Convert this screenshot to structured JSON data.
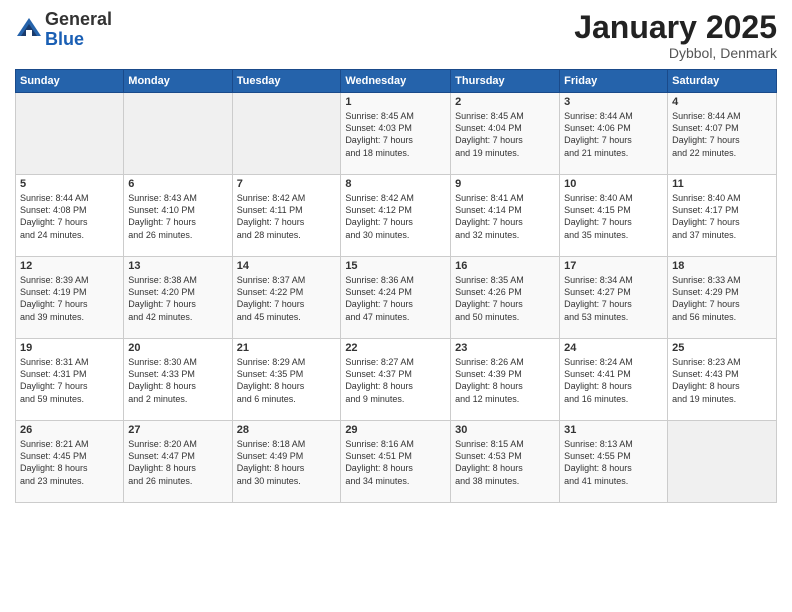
{
  "header": {
    "logo_general": "General",
    "logo_blue": "Blue",
    "month_title": "January 2025",
    "location": "Dybbol, Denmark"
  },
  "weekdays": [
    "Sunday",
    "Monday",
    "Tuesday",
    "Wednesday",
    "Thursday",
    "Friday",
    "Saturday"
  ],
  "weeks": [
    [
      {
        "day": "",
        "content": ""
      },
      {
        "day": "",
        "content": ""
      },
      {
        "day": "",
        "content": ""
      },
      {
        "day": "1",
        "content": "Sunrise: 8:45 AM\nSunset: 4:03 PM\nDaylight: 7 hours\nand 18 minutes."
      },
      {
        "day": "2",
        "content": "Sunrise: 8:45 AM\nSunset: 4:04 PM\nDaylight: 7 hours\nand 19 minutes."
      },
      {
        "day": "3",
        "content": "Sunrise: 8:44 AM\nSunset: 4:06 PM\nDaylight: 7 hours\nand 21 minutes."
      },
      {
        "day": "4",
        "content": "Sunrise: 8:44 AM\nSunset: 4:07 PM\nDaylight: 7 hours\nand 22 minutes."
      }
    ],
    [
      {
        "day": "5",
        "content": "Sunrise: 8:44 AM\nSunset: 4:08 PM\nDaylight: 7 hours\nand 24 minutes."
      },
      {
        "day": "6",
        "content": "Sunrise: 8:43 AM\nSunset: 4:10 PM\nDaylight: 7 hours\nand 26 minutes."
      },
      {
        "day": "7",
        "content": "Sunrise: 8:42 AM\nSunset: 4:11 PM\nDaylight: 7 hours\nand 28 minutes."
      },
      {
        "day": "8",
        "content": "Sunrise: 8:42 AM\nSunset: 4:12 PM\nDaylight: 7 hours\nand 30 minutes."
      },
      {
        "day": "9",
        "content": "Sunrise: 8:41 AM\nSunset: 4:14 PM\nDaylight: 7 hours\nand 32 minutes."
      },
      {
        "day": "10",
        "content": "Sunrise: 8:40 AM\nSunset: 4:15 PM\nDaylight: 7 hours\nand 35 minutes."
      },
      {
        "day": "11",
        "content": "Sunrise: 8:40 AM\nSunset: 4:17 PM\nDaylight: 7 hours\nand 37 minutes."
      }
    ],
    [
      {
        "day": "12",
        "content": "Sunrise: 8:39 AM\nSunset: 4:19 PM\nDaylight: 7 hours\nand 39 minutes."
      },
      {
        "day": "13",
        "content": "Sunrise: 8:38 AM\nSunset: 4:20 PM\nDaylight: 7 hours\nand 42 minutes."
      },
      {
        "day": "14",
        "content": "Sunrise: 8:37 AM\nSunset: 4:22 PM\nDaylight: 7 hours\nand 45 minutes."
      },
      {
        "day": "15",
        "content": "Sunrise: 8:36 AM\nSunset: 4:24 PM\nDaylight: 7 hours\nand 47 minutes."
      },
      {
        "day": "16",
        "content": "Sunrise: 8:35 AM\nSunset: 4:26 PM\nDaylight: 7 hours\nand 50 minutes."
      },
      {
        "day": "17",
        "content": "Sunrise: 8:34 AM\nSunset: 4:27 PM\nDaylight: 7 hours\nand 53 minutes."
      },
      {
        "day": "18",
        "content": "Sunrise: 8:33 AM\nSunset: 4:29 PM\nDaylight: 7 hours\nand 56 minutes."
      }
    ],
    [
      {
        "day": "19",
        "content": "Sunrise: 8:31 AM\nSunset: 4:31 PM\nDaylight: 7 hours\nand 59 minutes."
      },
      {
        "day": "20",
        "content": "Sunrise: 8:30 AM\nSunset: 4:33 PM\nDaylight: 8 hours\nand 2 minutes."
      },
      {
        "day": "21",
        "content": "Sunrise: 8:29 AM\nSunset: 4:35 PM\nDaylight: 8 hours\nand 6 minutes."
      },
      {
        "day": "22",
        "content": "Sunrise: 8:27 AM\nSunset: 4:37 PM\nDaylight: 8 hours\nand 9 minutes."
      },
      {
        "day": "23",
        "content": "Sunrise: 8:26 AM\nSunset: 4:39 PM\nDaylight: 8 hours\nand 12 minutes."
      },
      {
        "day": "24",
        "content": "Sunrise: 8:24 AM\nSunset: 4:41 PM\nDaylight: 8 hours\nand 16 minutes."
      },
      {
        "day": "25",
        "content": "Sunrise: 8:23 AM\nSunset: 4:43 PM\nDaylight: 8 hours\nand 19 minutes."
      }
    ],
    [
      {
        "day": "26",
        "content": "Sunrise: 8:21 AM\nSunset: 4:45 PM\nDaylight: 8 hours\nand 23 minutes."
      },
      {
        "day": "27",
        "content": "Sunrise: 8:20 AM\nSunset: 4:47 PM\nDaylight: 8 hours\nand 26 minutes."
      },
      {
        "day": "28",
        "content": "Sunrise: 8:18 AM\nSunset: 4:49 PM\nDaylight: 8 hours\nand 30 minutes."
      },
      {
        "day": "29",
        "content": "Sunrise: 8:16 AM\nSunset: 4:51 PM\nDaylight: 8 hours\nand 34 minutes."
      },
      {
        "day": "30",
        "content": "Sunrise: 8:15 AM\nSunset: 4:53 PM\nDaylight: 8 hours\nand 38 minutes."
      },
      {
        "day": "31",
        "content": "Sunrise: 8:13 AM\nSunset: 4:55 PM\nDaylight: 8 hours\nand 41 minutes."
      },
      {
        "day": "",
        "content": ""
      }
    ]
  ]
}
